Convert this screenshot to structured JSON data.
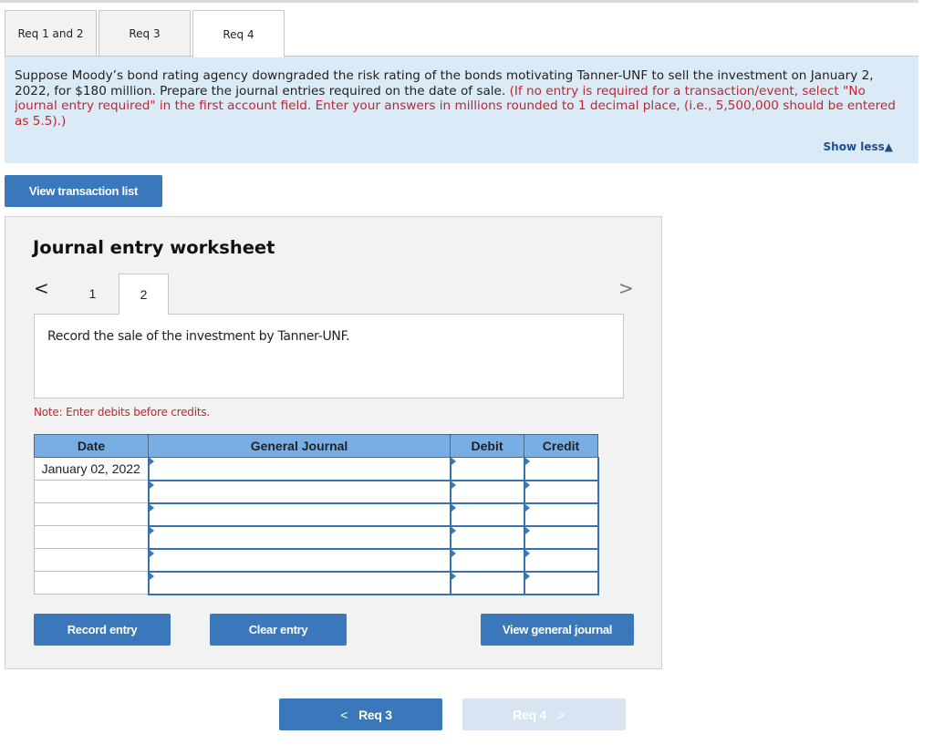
{
  "tabs": [
    {
      "label": "Req 1 and 2",
      "active": false
    },
    {
      "label": "Req 3",
      "active": false
    },
    {
      "label": "Req 4",
      "active": true
    }
  ],
  "prompt": {
    "text": "Suppose Moody’s bond rating agency downgraded the risk rating of the bonds motivating Tanner-UNF to sell the investment on January 2, 2022, for $180 million. Prepare the journal entries required on the date of sale.",
    "instruction": "(If no entry is required for a transaction/event, select \"No journal entry required\" in the first account field. Enter your answers in millions rounded to 1 decimal place, (i.e., 5,500,000 should be entered as 5.5).)",
    "show_less_label": "Show less",
    "show_less_icon": "triangle-up-icon"
  },
  "view_transaction_list_label": "View transaction list",
  "worksheet": {
    "title": "Journal entry worksheet",
    "prev_icon": "‹",
    "next_icon": "›",
    "pages": [
      "1",
      "2"
    ],
    "active_page": "2",
    "description": "Record the sale of the investment by Tanner-UNF.",
    "note": "Note: Enter debits before credits.",
    "columns": [
      "Date",
      "General Journal",
      "Debit",
      "Credit"
    ],
    "rows": [
      {
        "date": "January 02, 2022",
        "account": "",
        "debit": "",
        "credit": ""
      },
      {
        "date": "",
        "account": "",
        "debit": "",
        "credit": ""
      },
      {
        "date": "",
        "account": "",
        "debit": "",
        "credit": ""
      },
      {
        "date": "",
        "account": "",
        "debit": "",
        "credit": ""
      },
      {
        "date": "",
        "account": "",
        "debit": "",
        "credit": ""
      },
      {
        "date": "",
        "account": "",
        "debit": "",
        "credit": ""
      }
    ],
    "record_entry_label": "Record entry",
    "clear_entry_label": "Clear entry",
    "view_general_journal_label": "View general journal"
  },
  "footer_nav": {
    "prev_label": "Req 3",
    "next_label": "Req 4",
    "next_disabled": true
  },
  "colors": {
    "accent": "#3a77bb",
    "prompt_bg": "#dbeaf7",
    "instruction_red": "#c0272d",
    "table_header": "#78aee3"
  }
}
